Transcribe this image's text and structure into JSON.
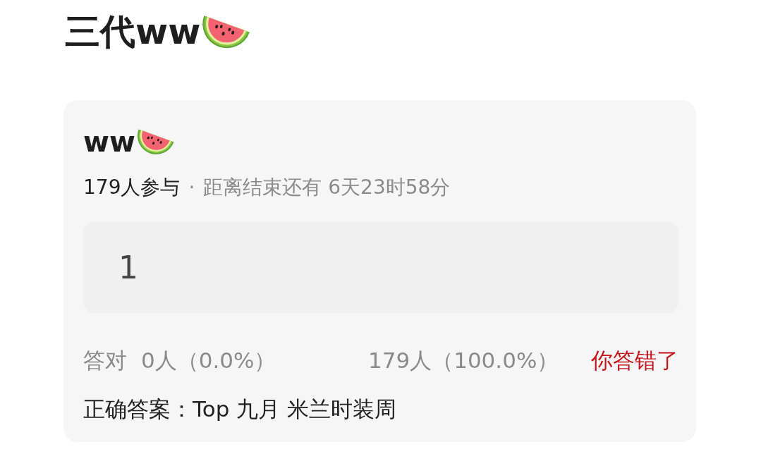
{
  "page_title": "三代ww",
  "quiz": {
    "title": "ww",
    "participants": "179人参与",
    "separator": "·",
    "countdown": "距离结束还有 6天23时58分",
    "answer": {
      "value": "1"
    },
    "stats": {
      "correct_label": "答对",
      "correct": "0人（0.0%）",
      "wrong": "179人（100.0%）",
      "result": {
        "text": "你答错了",
        "correct": false
      }
    },
    "correct_answer": "正确答案：Top 九月 米兰时装周"
  }
}
